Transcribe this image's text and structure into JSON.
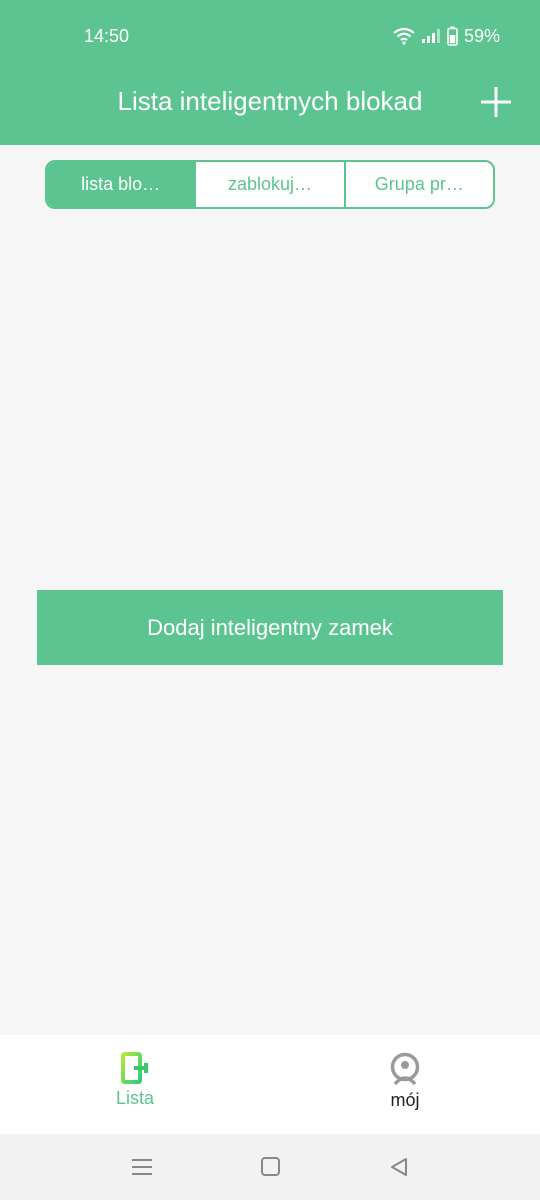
{
  "status_bar": {
    "time": "14:50",
    "battery_percent": "59%",
    "icons": [
      "wifi-icon",
      "signal-icon",
      "battery-icon"
    ]
  },
  "header": {
    "title": "Lista inteligentnych blokad",
    "add_icon": "plus-icon",
    "color": "#5cc490"
  },
  "tabs": [
    {
      "label": "lista blo…",
      "active": true
    },
    {
      "label": "zablokuj…",
      "active": false
    },
    {
      "label": "Grupa pr…",
      "active": false
    }
  ],
  "main": {
    "add_button_label": "Dodaj inteligentny zamek"
  },
  "bottom_nav": {
    "items": [
      {
        "label": "Lista",
        "icon": "door-icon",
        "active": true
      },
      {
        "label": "mój",
        "icon": "user-icon",
        "active": false
      }
    ]
  },
  "system_nav": {
    "icons": [
      "menu-icon",
      "home-icon",
      "back-icon"
    ]
  }
}
